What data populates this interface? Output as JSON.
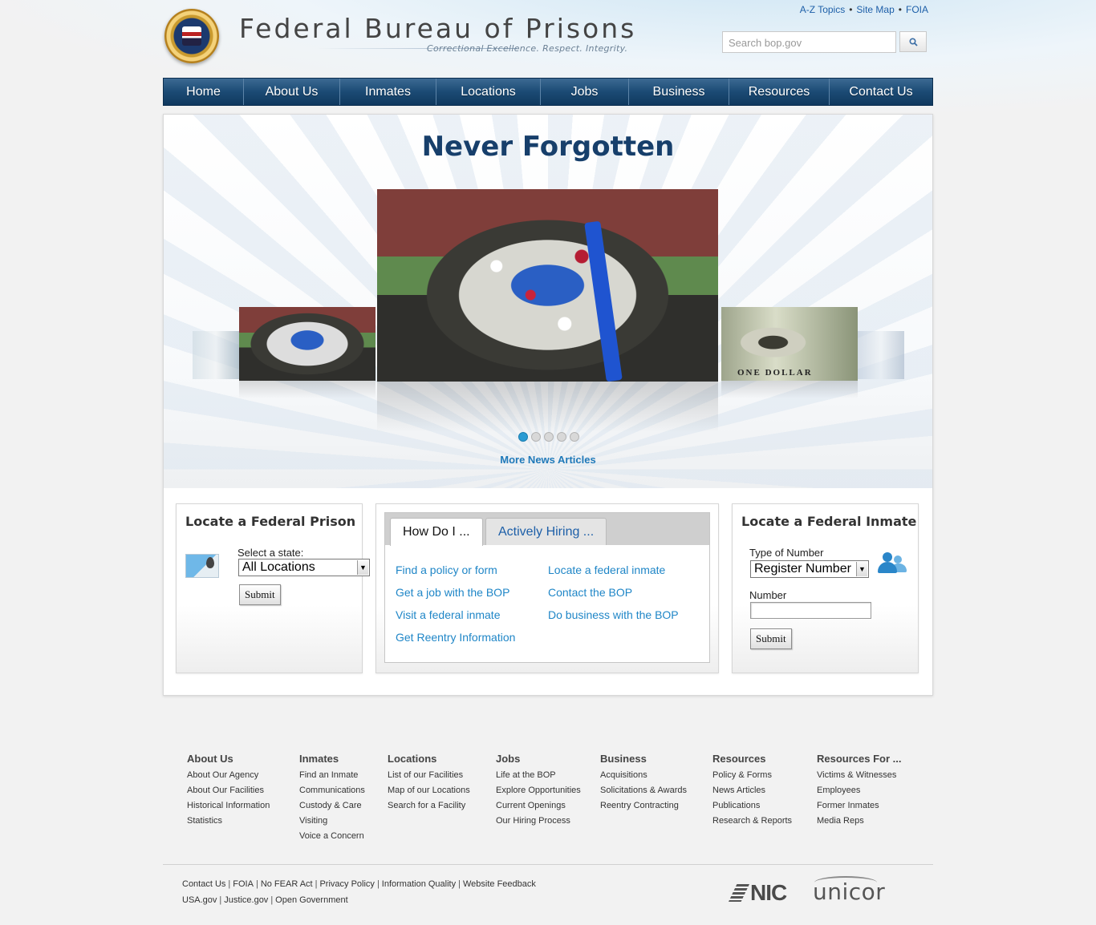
{
  "header": {
    "site_title": "Federal Bureau of Prisons",
    "tagline": "Correctional Excellence.  Respect.  Integrity.",
    "util_links": [
      "A-Z Topics",
      "Site Map",
      "FOIA"
    ],
    "search_placeholder": "Search bop.gov"
  },
  "nav": {
    "items": [
      "Home",
      "About Us",
      "Inmates",
      "Locations",
      "Jobs",
      "Business",
      "Resources",
      "Contact Us"
    ]
  },
  "hero": {
    "title": "Never Forgotten",
    "more_news": "More News Articles",
    "slide_count": 5,
    "active_slide": 1,
    "bill_text": "ONE DOLLAR"
  },
  "locate_prison": {
    "title": "Locate a Federal Prison",
    "select_label": "Select a state:",
    "select_value": "All Locations",
    "submit": "Submit"
  },
  "how_do_i": {
    "tabs": [
      "How Do I ...",
      "Actively Hiring ..."
    ],
    "links_left": [
      "Find a policy or form",
      "Get a job with the BOP",
      "Visit a federal inmate",
      "Get Reentry Information"
    ],
    "links_right": [
      "Locate a federal inmate",
      "Contact the BOP",
      "Do business with the BOP"
    ]
  },
  "locate_inmate": {
    "title": "Locate a Federal Inmate",
    "type_label": "Type of Number",
    "type_value": "Register Number",
    "number_label": "Number",
    "number_value": "",
    "submit": "Submit"
  },
  "footer": {
    "columns": [
      {
        "heading": "About Us",
        "links": [
          "About Our Agency",
          "About Our Facilities",
          "Historical Information",
          "Statistics"
        ]
      },
      {
        "heading": "Inmates",
        "links": [
          "Find an Inmate",
          "Communications",
          "Custody & Care",
          "Visiting",
          "Voice a Concern"
        ]
      },
      {
        "heading": "Locations",
        "links": [
          "List of our Facilities",
          "Map of our Locations",
          "Search for a Facility"
        ]
      },
      {
        "heading": "Jobs",
        "links": [
          "Life at the BOP",
          "Explore Opportunities",
          "Current Openings",
          "Our Hiring Process"
        ]
      },
      {
        "heading": "Business",
        "links": [
          "Acquisitions",
          "Solicitations & Awards",
          "Reentry Contracting"
        ]
      },
      {
        "heading": "Resources",
        "links": [
          "Policy & Forms",
          "News Articles",
          "Publications",
          "Research & Reports"
        ]
      },
      {
        "heading": "Resources For ...",
        "links": [
          "Victims & Witnesses",
          "Employees",
          "Former Inmates",
          "Media Reps"
        ]
      }
    ],
    "legal_row1": [
      "Contact Us",
      "FOIA",
      "No FEAR Act",
      "Privacy Policy",
      "Information Quality",
      "Website Feedback"
    ],
    "legal_row2": [
      "USA.gov",
      "Justice.gov",
      "Open Government"
    ],
    "logos": [
      "NIC",
      "unicor"
    ]
  }
}
